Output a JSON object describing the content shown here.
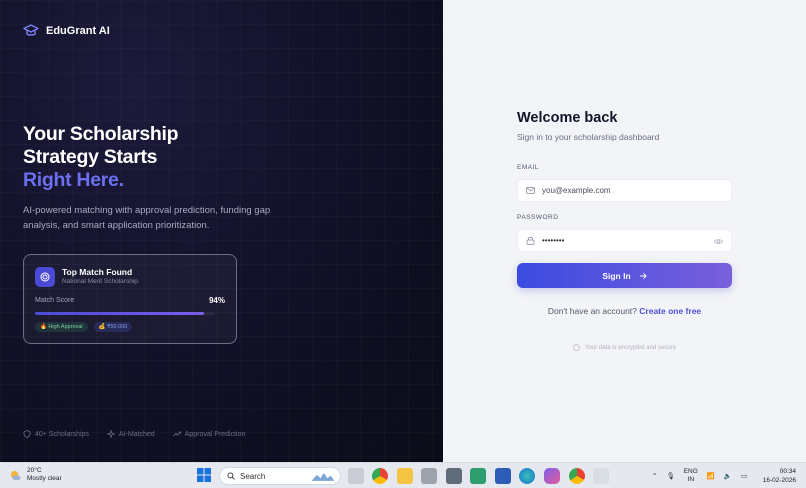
{
  "brand": {
    "name": "EduGrant AI"
  },
  "hero": {
    "headline_line1": "Your Scholarship",
    "headline_line2": "Strategy Starts",
    "headline_accent": "Right Here.",
    "subtext": "AI-powered matching with approval prediction, funding gap analysis, and smart application prioritization.",
    "card": {
      "title": "Top Match Found",
      "subtitle": "National Merit Scholarship",
      "score_label": "Match Score",
      "score_value": "94%",
      "score_fraction": 0.94,
      "tags": [
        "🔥 High Approval",
        "💰 ₹50,000"
      ]
    },
    "features": [
      "40+ Scholarships",
      "AI-Matched",
      "Approval Prediction"
    ]
  },
  "auth": {
    "title": "Welcome back",
    "subtitle": "Sign in to your scholarship dashboard",
    "email_label": "EMAIL",
    "email_placeholder": "you@example.com",
    "password_label": "PASSWORD",
    "password_value": "••••••••",
    "signin_label": "Sign In",
    "signup_prompt": "Don't have an account?",
    "signup_link": "Create one free",
    "secure_note": "Your data is encrypted and secure"
  },
  "taskbar": {
    "weather_temp": "20°C",
    "weather_desc": "Mostly clear",
    "search_label": "Search",
    "lang_line1": "ENG",
    "lang_line2": "IN",
    "time": "00:34",
    "date": "16-02-2026"
  },
  "colors": {
    "accent": "#6b6ff0",
    "button_start": "#3b4be0",
    "button_end": "#7a5fdc",
    "hero_bg": "#13122a"
  }
}
